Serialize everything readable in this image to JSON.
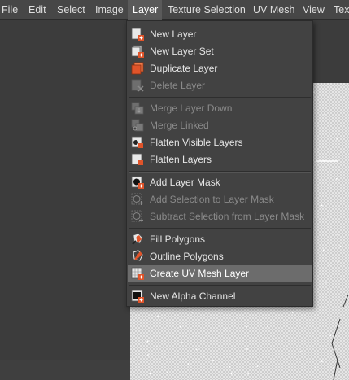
{
  "menubar": {
    "items": [
      "File",
      "Edit",
      "Select",
      "Image",
      "Layer",
      "Texture Selection",
      "UV Mesh",
      "View",
      "Tex"
    ],
    "active": "Layer"
  },
  "layer_menu": {
    "items": [
      {
        "label": "New Layer",
        "enabled": true,
        "icon": "new-layer-icon"
      },
      {
        "label": "New Layer Set",
        "enabled": true,
        "icon": "new-layer-set-icon"
      },
      {
        "label": "Duplicate Layer",
        "enabled": true,
        "icon": "duplicate-layer-icon"
      },
      {
        "label": "Delete Layer",
        "enabled": false,
        "icon": "delete-layer-icon"
      },
      {
        "label": "Merge Layer Down",
        "enabled": false,
        "icon": "merge-layer-down-icon"
      },
      {
        "label": "Merge Linked",
        "enabled": false,
        "icon": "merge-linked-icon"
      },
      {
        "label": "Flatten Visible Layers",
        "enabled": true,
        "icon": "flatten-visible-layers-icon"
      },
      {
        "label": "Flatten Layers",
        "enabled": true,
        "icon": "flatten-layers-icon"
      },
      {
        "label": "Add Layer Mask",
        "enabled": true,
        "icon": "add-layer-mask-icon"
      },
      {
        "label": "Add Selection to Layer Mask",
        "enabled": false,
        "icon": "add-selection-mask-icon"
      },
      {
        "label": "Subtract Selection from Layer Mask",
        "enabled": false,
        "icon": "subtract-selection-mask-icon"
      },
      {
        "label": "Fill Polygons",
        "enabled": true,
        "icon": "fill-polygons-icon"
      },
      {
        "label": "Outline Polygons",
        "enabled": true,
        "icon": "outline-polygons-icon"
      },
      {
        "label": "Create UV Mesh Layer",
        "enabled": true,
        "highlighted": true,
        "icon": "uv-mesh-layer-icon"
      },
      {
        "label": "New Alpha Channel",
        "enabled": true,
        "icon": "new-alpha-channel-icon"
      }
    ]
  },
  "colors": {
    "menubar_bg": "#474747",
    "menu_bg": "#424242",
    "highlight": "#6c6c6c",
    "icon_accent": "#e0542a",
    "disabled_text": "#8a8a8a"
  }
}
